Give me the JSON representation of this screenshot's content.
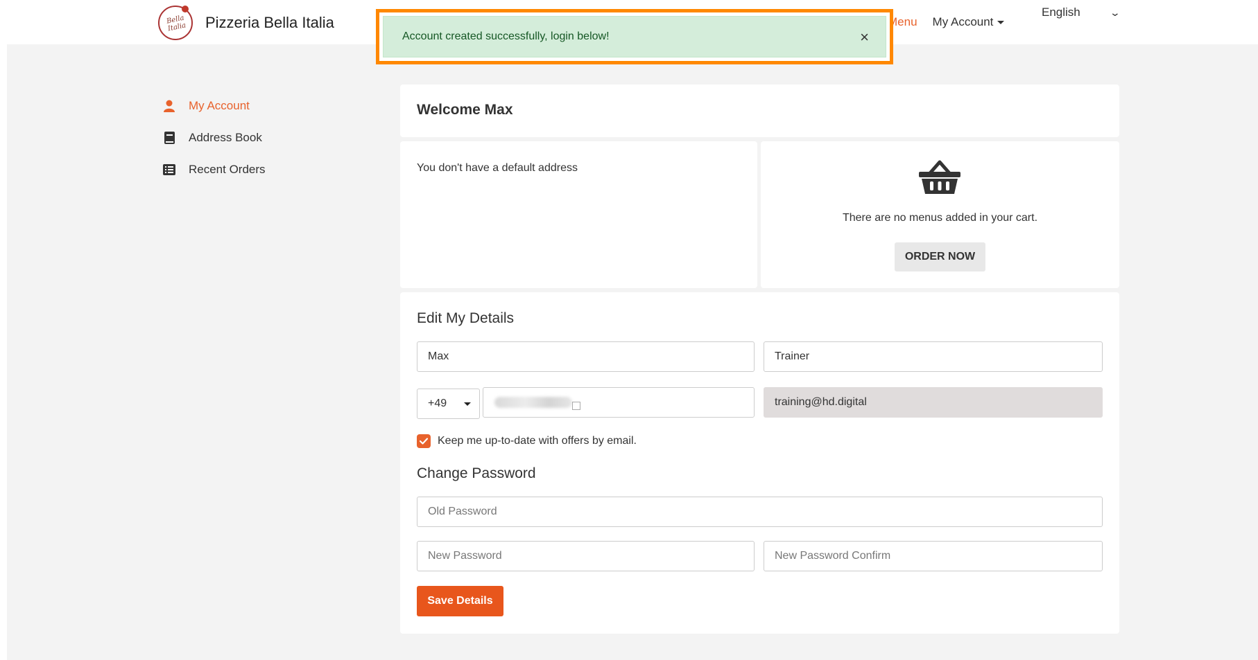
{
  "brand": {
    "name": "Pizzeria Bella Italia",
    "logo_text": "Bella Italia"
  },
  "nav": {
    "menu": "Menu",
    "account": "My Account",
    "language": "English"
  },
  "toast": {
    "message": "Account created successfully, login below!",
    "close": "×"
  },
  "sidebar": {
    "items": [
      {
        "label": "My Account",
        "icon": "user-icon",
        "active": true
      },
      {
        "label": "Address Book",
        "icon": "book-icon",
        "active": false
      },
      {
        "label": "Recent Orders",
        "icon": "list-icon",
        "active": false
      }
    ]
  },
  "welcome": {
    "title": "Welcome Max"
  },
  "address": {
    "text": "You don't have a default address"
  },
  "cart": {
    "empty_text": "There are no menus added in your cart.",
    "order_button": "ORDER NOW",
    "icon": "basket-icon"
  },
  "details": {
    "title": "Edit My Details",
    "first_name": "Max",
    "last_name": "Trainer",
    "country_code": "+49",
    "email": "training@hd.digital",
    "newsletter_label": "Keep me up-to-date with offers by email.",
    "newsletter_checked": true
  },
  "password": {
    "title": "Change Password",
    "old_placeholder": "Old Password",
    "new_placeholder": "New Password",
    "confirm_placeholder": "New Password Confirm"
  },
  "save_button": "Save Details",
  "colors": {
    "accent": "#e8622c",
    "toast_bg": "#d4edda",
    "highlight": "#ff8800"
  }
}
